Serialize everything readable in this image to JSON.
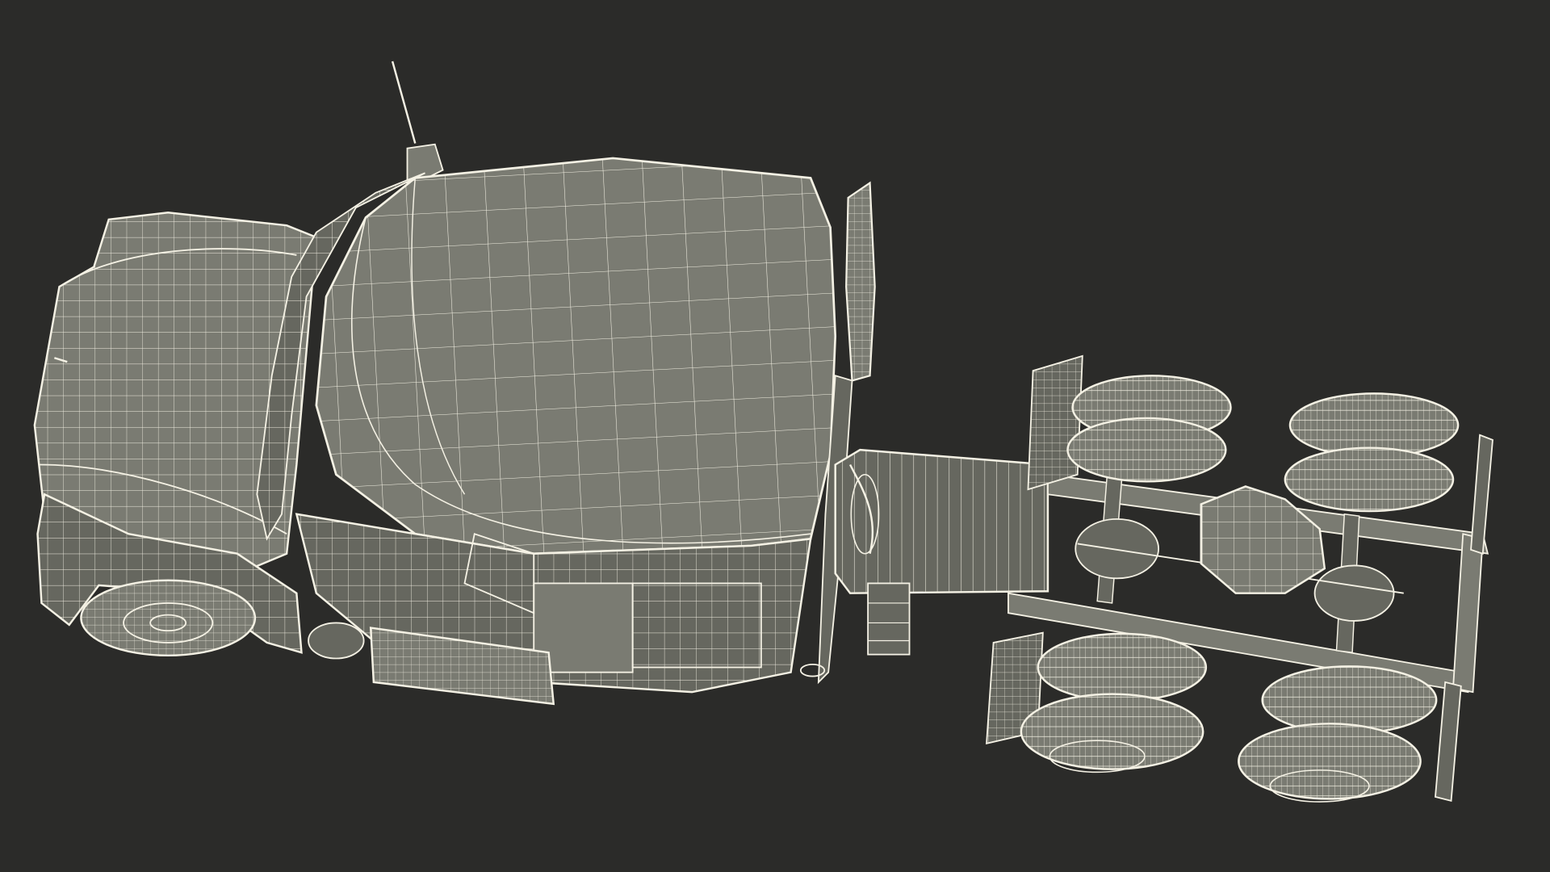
{
  "scene": {
    "subject": "",
    "colors": {
      "background": "#2b2b29",
      "surface": "#7a7b72",
      "surface_dark": "#66675f",
      "wire": "#f4f1e4",
      "wire_dim": "#d9d6c8"
    }
  }
}
